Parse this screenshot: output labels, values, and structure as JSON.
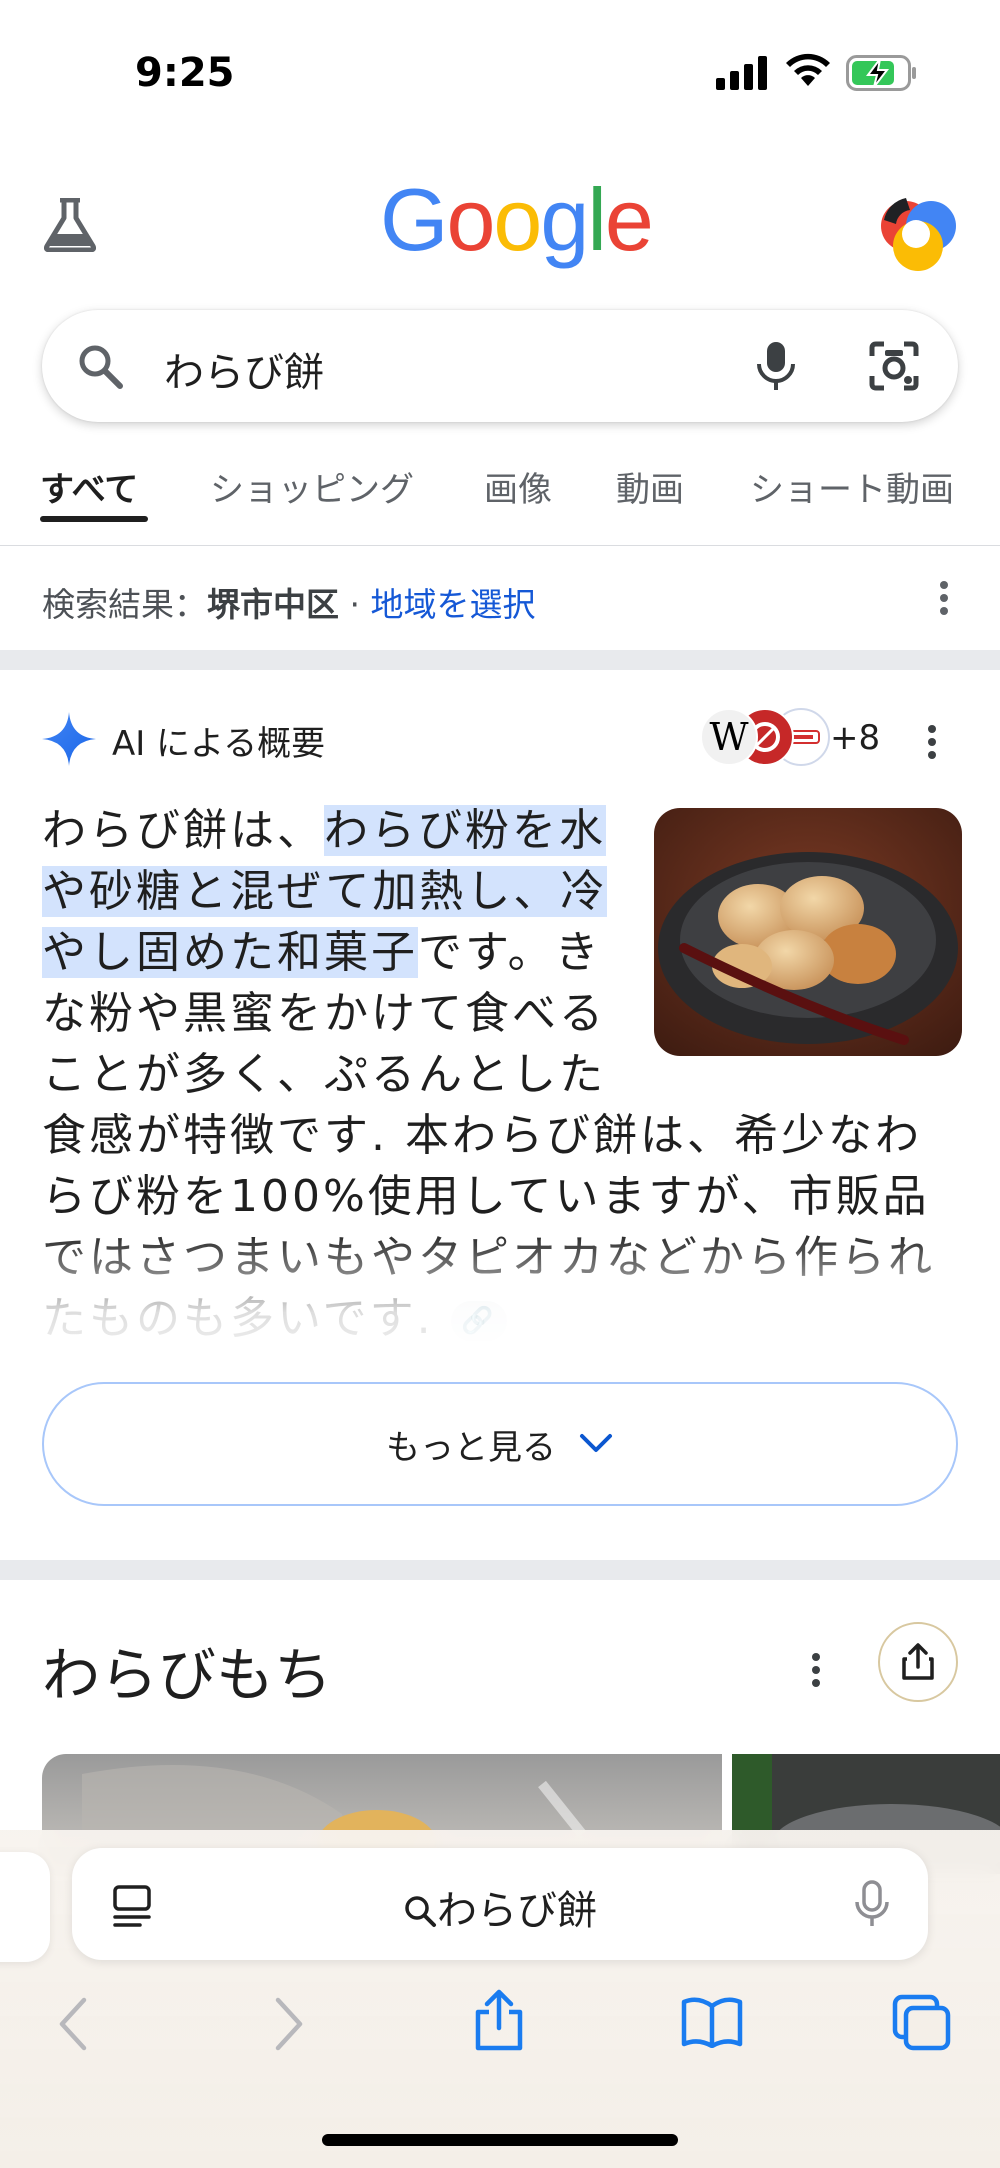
{
  "status_bar": {
    "time": "9:25"
  },
  "header": {
    "logo_text": "Google"
  },
  "search": {
    "query": "わらび餅"
  },
  "tabs": [
    {
      "label": "すべて",
      "active": true
    },
    {
      "label": "ショッピング"
    },
    {
      "label": "画像"
    },
    {
      "label": "動画"
    },
    {
      "label": "ショート動画"
    }
  ],
  "location": {
    "prefix": "検索結果：",
    "area": "堺市中区",
    "sep": " · ",
    "link": "地域を選択"
  },
  "ai_overview": {
    "title": "AI による概要",
    "sources_count": "+8",
    "text_intro": "わらび餅は、",
    "text_highlight": "わらび粉を水や砂糖と混ぜて加熱し、冷やし固めた和菓子",
    "text_rest": "です。きな粉や黒蜜をかけて食べることが多く、ぷるんとした食感が特徴です. 本わらび餅は、希少なわらび粉を100%使用していますが、市販品ではさつまいもやタピオカなどから作られたものも多いです.",
    "more_button": "もっと見る"
  },
  "knowledge_panel": {
    "title": "わらびもち"
  },
  "safari": {
    "address_text": "わらび餅"
  },
  "colors": {
    "accent_blue": "#1558d6",
    "highlight": "#d3e3fd",
    "safari_blue": "#1a7cf0"
  }
}
